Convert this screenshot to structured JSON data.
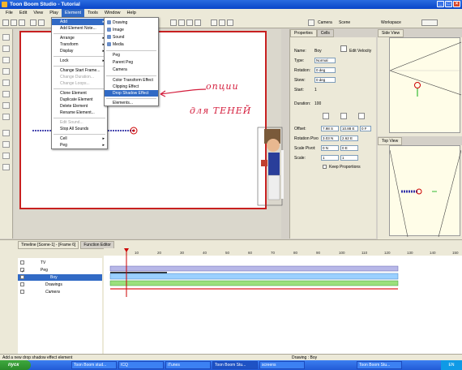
{
  "window": {
    "title": "Toon Boom Studio - Tutorial"
  },
  "menubar": [
    "File",
    "Edit",
    "View",
    "Play",
    "Element",
    "Tools",
    "Window",
    "Help"
  ],
  "toolbar": {
    "camera_label": "Camera",
    "scene_label": "Scene",
    "workspace_label": "Workspace"
  },
  "element_menu": [
    {
      "label": "Add",
      "state": "highlighted",
      "submenu": true
    },
    {
      "label": "Add Element Note...",
      "state": "normal"
    },
    {
      "label": "Arrange",
      "state": "normal",
      "submenu": true
    },
    {
      "label": "Transform",
      "state": "normal",
      "submenu": true
    },
    {
      "label": "Display",
      "state": "normal",
      "submenu": true
    },
    {
      "label": "Lock",
      "state": "normal",
      "submenu": true
    },
    {
      "label": "Change Start Frame...",
      "state": "normal"
    },
    {
      "label": "Change Duration...",
      "state": "disabled"
    },
    {
      "label": "Change Loops...",
      "state": "disabled"
    },
    {
      "label": "Clone Element",
      "state": "normal"
    },
    {
      "label": "Duplicate Element",
      "state": "normal"
    },
    {
      "label": "Delete Element",
      "state": "normal"
    },
    {
      "label": "Rename Element...",
      "state": "normal"
    },
    {
      "label": "Edit Sound...",
      "state": "disabled"
    },
    {
      "label": "Stop All Sounds",
      "state": "normal"
    },
    {
      "label": "Cell",
      "state": "normal",
      "submenu": true
    },
    {
      "label": "Peg",
      "state": "normal",
      "submenu": true
    }
  ],
  "add_submenu": [
    {
      "label": "Drawing",
      "state": "normal"
    },
    {
      "label": "Image",
      "state": "normal"
    },
    {
      "label": "Sound",
      "state": "normal"
    },
    {
      "label": "Media",
      "state": "normal"
    },
    {
      "label": "Peg",
      "state": "normal"
    },
    {
      "label": "Parent Peg",
      "state": "normal"
    },
    {
      "label": "Camera",
      "state": "normal"
    },
    {
      "label": "Color Transform Effect",
      "state": "normal"
    },
    {
      "label": "Clipping Effect",
      "state": "normal"
    },
    {
      "label": "Drop Shadow Effect",
      "state": "highlighted"
    },
    {
      "label": "Elements...",
      "state": "normal"
    }
  ],
  "annotation": {
    "line1": "опции",
    "line2": "для ТЕНЕЙ"
  },
  "properties": {
    "tabs": [
      "Properties",
      "Cells"
    ],
    "name_label": "Name:",
    "name_value": "Boy",
    "edit_velocity": "Edit Velocity",
    "type_label": "Type:",
    "type_value": "Normal",
    "rotation_label": "Rotation:",
    "rotation_value": "0 deg",
    "skew_label": "Skew:",
    "skew_value": "0 deg",
    "start_label": "Start:",
    "start_value": "1",
    "duration_label": "Duration:",
    "duration_value": "100",
    "offset_label": "Offset:",
    "offset_x": "7.98 S",
    "offset_y": "10.88 E",
    "offset_z": "0 F",
    "rotation_pivot_label": "Rotation Pivo",
    "rotation_pivot_x": "3.03 N",
    "rotation_pivot_y": "2.62 E",
    "scale_pivot_label": "Scale Pivot:",
    "scale_pivot_x": "0 N",
    "scale_pivot_y": "0 E",
    "scale_label": "Scale:",
    "scale_x": "1",
    "scale_y": "1",
    "keep_proportions": "Keep Proportions"
  },
  "side_view": {
    "title": "Side View"
  },
  "top_view": {
    "title": "Top View"
  },
  "timeline": {
    "tabs": [
      "Timeline [Scene-1] - [Frame 6]",
      "Function Editor"
    ],
    "frames": [
      "10",
      "20",
      "30",
      "40",
      "50",
      "60",
      "70",
      "80",
      "90",
      "100",
      "110",
      "120",
      "130",
      "140",
      "150"
    ],
    "layers": [
      {
        "name": "TV",
        "checked": false,
        "selected": false
      },
      {
        "name": "Peg",
        "checked": true,
        "selected": false
      },
      {
        "name": "Boy",
        "checked": true,
        "selected": true
      },
      {
        "name": "Drawings",
        "checked": true,
        "selected": false
      },
      {
        "name": "Camera",
        "checked": true,
        "selected": false
      }
    ]
  },
  "status": {
    "left": "Add a new drop shadow effect element",
    "center": "Drawing : Boy"
  },
  "taskbar": {
    "start": "пуск",
    "tasks": [
      "Toon Boom stud...",
      "ICQ",
      "iTunes",
      "Toon Boom Stu...",
      "screens",
      "Toon Boom Stu..."
    ],
    "active_index": 3,
    "tray": "EN"
  },
  "colors": {
    "highlight": "#316ac5",
    "annotation": "#d41d3c",
    "stage_border": "#c82020"
  }
}
